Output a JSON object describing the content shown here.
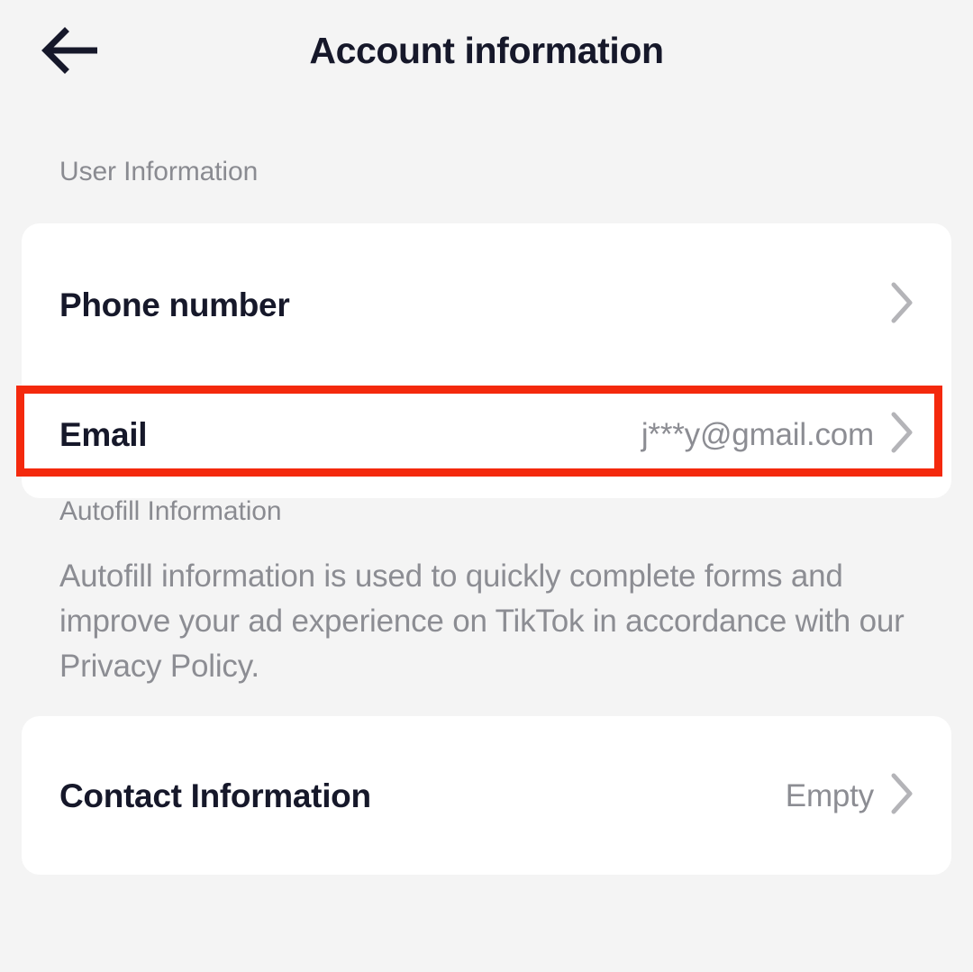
{
  "header": {
    "title": "Account information",
    "back_icon": "arrow-left-icon"
  },
  "sections": {
    "user_information": {
      "label": "User Information",
      "rows": [
        {
          "label": "Phone number",
          "value": "",
          "chevron": "chevron-right-icon"
        },
        {
          "label": "Email",
          "value": "j***y@gmail.com",
          "chevron": "chevron-right-icon",
          "highlighted": true
        }
      ]
    },
    "autofill_information": {
      "label": "Autofill Information",
      "description": "Autofill information is used to quickly complete forms and improve your ad experience on TikTok in accordance with our Privacy Policy.",
      "rows": [
        {
          "label": "Contact Information",
          "value": "Empty",
          "chevron": "chevron-right-icon"
        }
      ]
    }
  },
  "colors": {
    "background": "#f4f4f4",
    "card": "#ffffff",
    "text_primary": "#16182a",
    "text_secondary": "#8c8d93",
    "highlight": "#f4290d",
    "chevron": "#b4b4b8"
  }
}
